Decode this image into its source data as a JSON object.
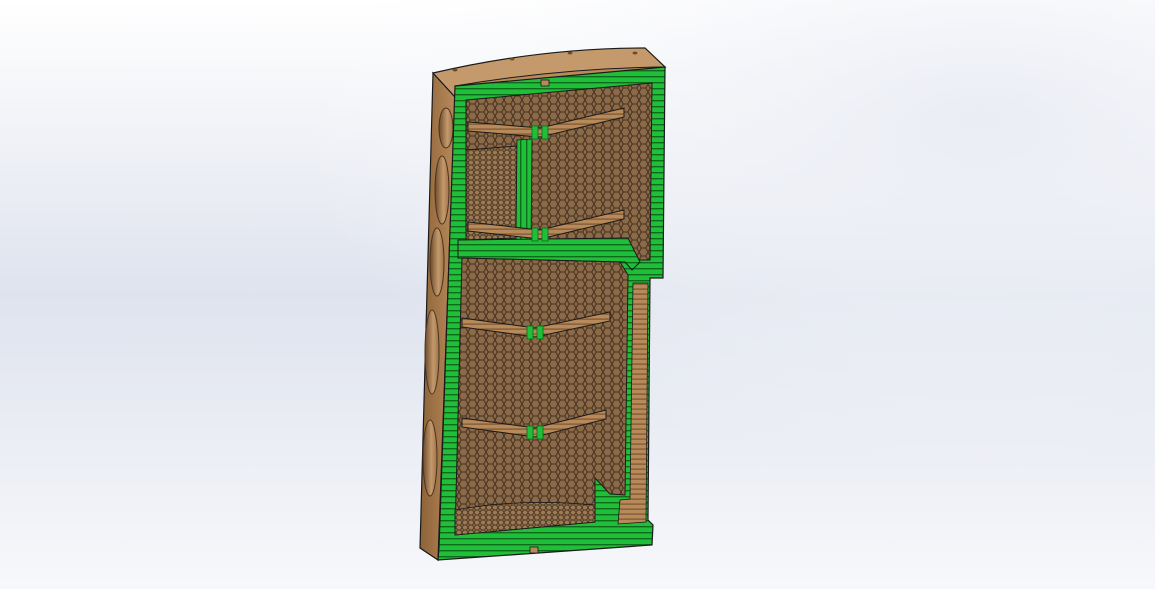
{
  "viewport": {
    "background_top": "#ffffff",
    "background_mid": "#dfe3ee",
    "background_bottom": "#f7f8fb"
  },
  "model": {
    "colors": {
      "section_face": "#1fbf3a",
      "section_stripe": "#0d6b1a",
      "wood": "#b88a5a",
      "wood_dark": "#7a5533",
      "wood_light": "#cfa677",
      "honeycomb_fill": "#8a6a48",
      "honeycomb_line": "#4a3320",
      "outline": "#1a1a1a"
    },
    "shelves": 4,
    "side_driver_recesses": 5
  }
}
